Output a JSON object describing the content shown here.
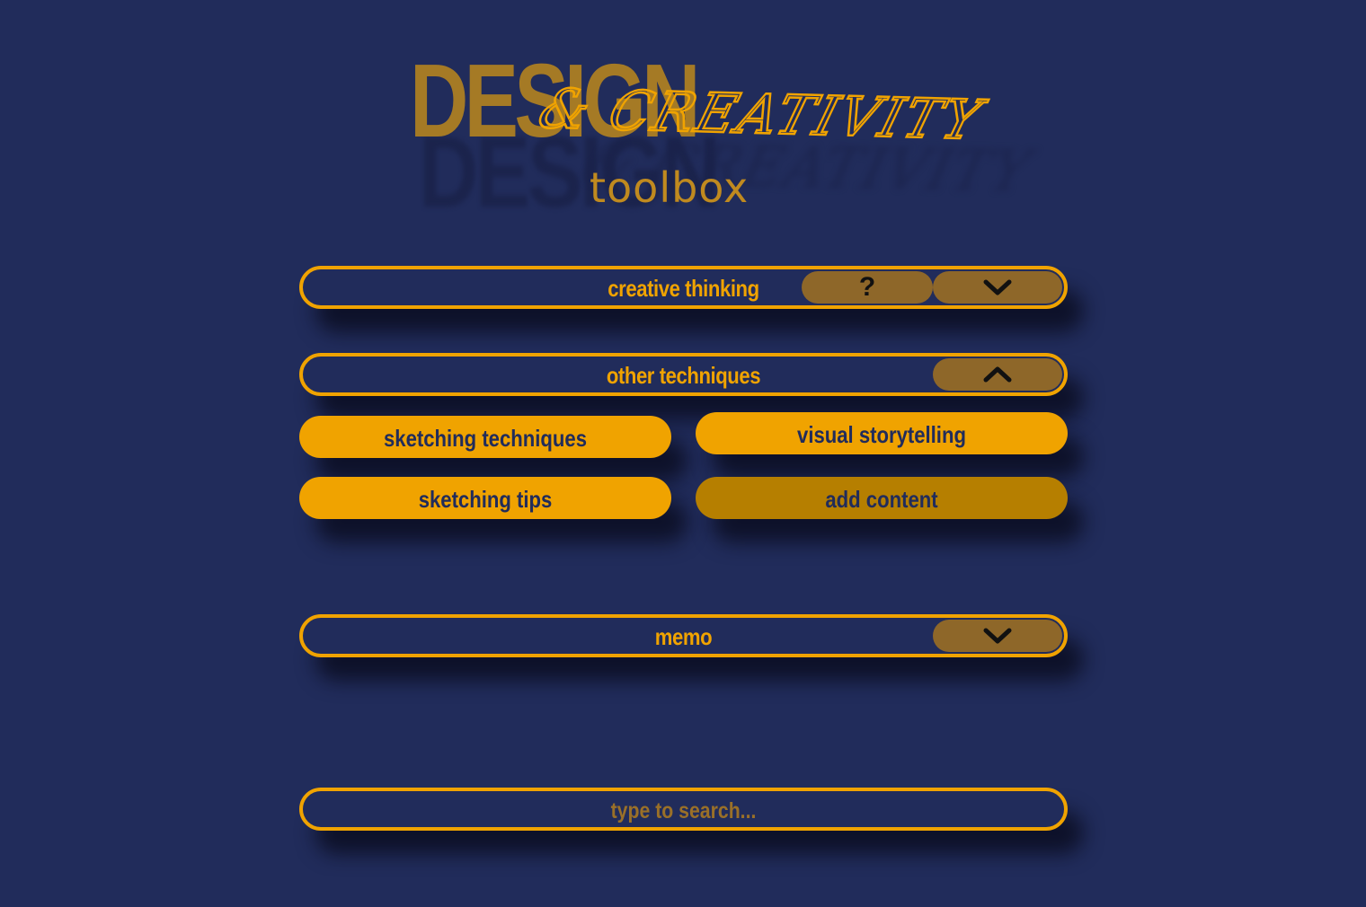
{
  "logo": {
    "word1": "DESIGN",
    "word2": "& CREATIVITY",
    "word3": "toolbox"
  },
  "sections": {
    "creative_thinking": {
      "label": "creative thinking",
      "help_label": "?",
      "toggle_icon": "chevron-down-icon",
      "expanded": false
    },
    "other_techniques": {
      "label": "other techniques",
      "toggle_icon": "chevron-up-icon",
      "expanded": true,
      "items": [
        "sketching techniques",
        "visual storytelling",
        "sketching tips",
        "add content"
      ]
    },
    "memo": {
      "label": "memo",
      "toggle_icon": "chevron-down-icon",
      "expanded": false
    }
  },
  "search": {
    "placeholder": "type to search...",
    "value": ""
  },
  "colors": {
    "background": "#212c5b",
    "accent": "#f0a300",
    "accent_muted": "#b67f00",
    "button_fill": "#8e6729",
    "logo_gold": "#a57a25"
  }
}
